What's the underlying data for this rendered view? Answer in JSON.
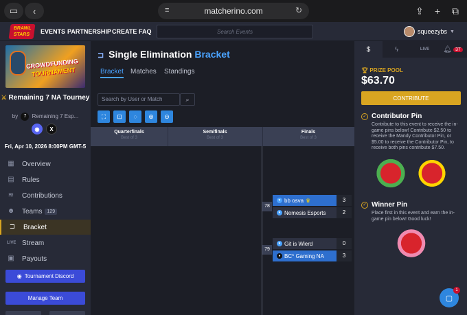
{
  "browser": {
    "url": "matcherino.com"
  },
  "nav": {
    "logo": "BRAWL STARS",
    "links": [
      "EVENTS",
      "PARTNERSHIP",
      "CREATE",
      "FAQ"
    ],
    "search_placeholder": "Search Events",
    "username": "squeezybs"
  },
  "sidebar": {
    "banner_line1": "CROWDFUNDING",
    "banner_line2": "TOURNAMENT",
    "tournament_name": "Remaining 7 NA Tourney",
    "by": "by",
    "org_initial": "7",
    "organizer": "Remaining 7 Esp...",
    "date": "Fri, Apr 10, 2026 8:00PM GMT-5",
    "menu": [
      {
        "label": "Overview",
        "icon": "grid-icon"
      },
      {
        "label": "Rules",
        "icon": "rules-icon"
      },
      {
        "label": "Contributions",
        "icon": "coins-icon"
      },
      {
        "label": "Teams",
        "icon": "teams-icon",
        "badge": "129"
      },
      {
        "label": "Bracket",
        "icon": "bracket-icon",
        "active": true
      },
      {
        "label": "Stream",
        "icon": "live-icon"
      },
      {
        "label": "Payouts",
        "icon": "payouts-icon"
      }
    ],
    "discord_button": "Tournament Discord",
    "manage_button": "Manage Team"
  },
  "main": {
    "title_part1": "Single Elimination",
    "title_part2": "Bracket",
    "tabs": [
      "Bracket",
      "Matches",
      "Standings"
    ],
    "search_placeholder": "Search by User or Match",
    "rounds": [
      {
        "name": "Quarterfinals",
        "sub": "Best of 3"
      },
      {
        "name": "Semifinals",
        "sub": "Best of 3"
      },
      {
        "name": "Finals",
        "sub": "Best of 3"
      }
    ],
    "matches": [
      {
        "id": "78",
        "teams": [
          {
            "name": "bb osva",
            "score": "3",
            "winner": true,
            "crown": true
          },
          {
            "name": "Nemesis Esports",
            "score": "2",
            "winner": false
          }
        ]
      },
      {
        "id": "79",
        "teams": [
          {
            "name": "Git is Wierd",
            "score": "0",
            "winner": false
          },
          {
            "name": "BC* Gaming NA",
            "score": "3",
            "winner": true
          }
        ]
      }
    ]
  },
  "right": {
    "tab_badge": "37",
    "prize_label": "PRIZE POOL",
    "prize_amount": "$63.70",
    "contribute_button": "CONTRIBUTE",
    "contributor_title": "Contributor Pin",
    "contributor_desc": "Contribute to this event to receive the in-game pins below! Contribute $2.50 to receive the Mandy Contributor Pin, or $5.00 to receive the Contributor Pin, to receive both pins contribute $7.50.",
    "winner_title": "Winner Pin",
    "winner_desc": "Place first in this event and earn the in-game pin below! Good luck!"
  },
  "chat_badge": "1",
  "colors": {
    "accent_blue": "#4aa3ff",
    "gold": "#d9a521",
    "discord": "#3b4bd8"
  }
}
